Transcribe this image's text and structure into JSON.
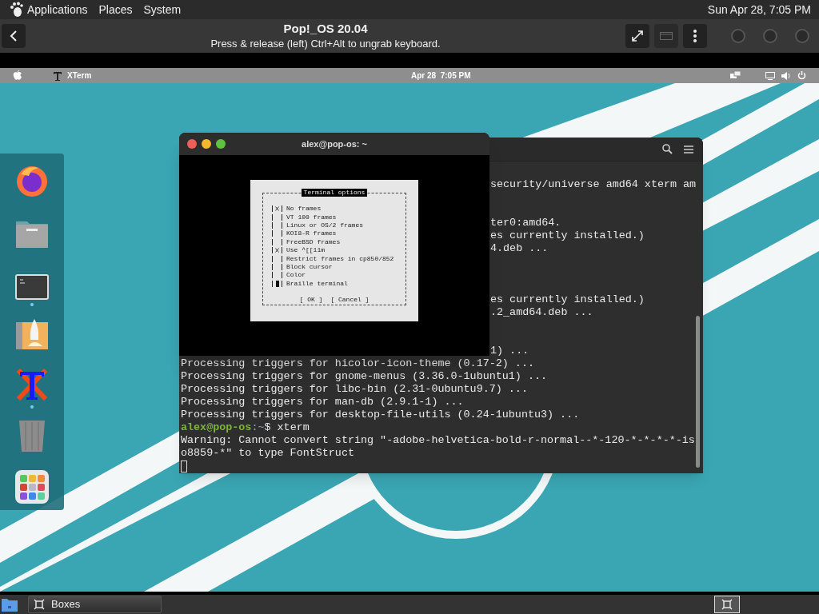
{
  "host_top_bar": {
    "menus": [
      "Applications",
      "Places",
      "System"
    ],
    "clock": "Sun Apr 28, 7:05 PM"
  },
  "boxes_header": {
    "title": "Pop!_OS 20.04",
    "subtitle": "Press & release (left) Ctrl+Alt to ungrab keyboard."
  },
  "guest_top_bar": {
    "app_name": "XTerm",
    "clock": "Apr 28  7:05 PM"
  },
  "dock": {
    "items": [
      {
        "kind": "firefox",
        "running": false
      },
      {
        "kind": "files",
        "running": false
      },
      {
        "kind": "terminal",
        "running": true
      },
      {
        "kind": "installer",
        "running": false
      },
      {
        "kind": "xterm",
        "running": true
      },
      {
        "kind": "trash",
        "running": false
      },
      {
        "kind": "apps",
        "running": false
      }
    ]
  },
  "back_terminal": {
    "lines": [
      {
        "kind": "clipped",
        "text": "security/universe amd64 xterm am"
      },
      {
        "kind": "hidden"
      },
      {
        "kind": "hidden"
      },
      {
        "kind": "clipped",
        "text": "ter0:amd64."
      },
      {
        "kind": "clipped",
        "text": "es currently installed.)"
      },
      {
        "kind": "clipped",
        "text": "4.deb ..."
      },
      {
        "kind": "hidden"
      },
      {
        "kind": "hidden"
      },
      {
        "kind": "hidden"
      },
      {
        "kind": "clipped",
        "text": "es currently installed.)"
      },
      {
        "kind": "clipped",
        "text": ".2_amd64.deb ..."
      },
      {
        "kind": "hidden"
      },
      {
        "kind": "hidden"
      },
      {
        "kind": "clipped",
        "text": "1) ..."
      },
      {
        "kind": "full",
        "text": "Processing triggers for hicolor-icon-theme (0.17-2) ..."
      },
      {
        "kind": "full",
        "text": "Processing triggers for gnome-menus (3.36.0-1ubuntu1) ..."
      },
      {
        "kind": "full",
        "text": "Processing triggers for libc-bin (2.31-0ubuntu9.7) ..."
      },
      {
        "kind": "full",
        "text": "Processing triggers for man-db (2.9.1-1) ..."
      },
      {
        "kind": "full",
        "text": "Processing triggers for desktop-file-utils (0.24-1ubuntu3) ..."
      },
      {
        "kind": "prompt",
        "user_host": "alex@pop-os",
        "path": ":~",
        "command": "$ xterm"
      },
      {
        "kind": "full",
        "text": "Warning: Cannot convert string \"-adobe-helvetica-bold-r-normal--*-120-*-*-*-*-is"
      },
      {
        "kind": "full",
        "text": "o8859-*\" to type FontStruct"
      },
      {
        "kind": "cursor"
      }
    ]
  },
  "xterm_window": {
    "title": "alex@pop-os: ~",
    "dialog": {
      "title": "Terminal options",
      "options": [
        {
          "label": "No frames",
          "checked": true,
          "focused": false
        },
        {
          "label": "VT 100 frames",
          "checked": false,
          "focused": false
        },
        {
          "label": "Linux or OS/2 frames",
          "checked": false,
          "focused": false
        },
        {
          "label": "KOI8-R frames",
          "checked": false,
          "focused": false
        },
        {
          "label": "FreeBSD frames",
          "checked": false,
          "focused": false
        },
        {
          "label": "Use ^[[11m",
          "checked": true,
          "focused": false
        },
        {
          "label": "Restrict frames in cp850/852",
          "checked": false,
          "focused": false
        },
        {
          "label": "Block cursor",
          "checked": false,
          "focused": false
        },
        {
          "label": "Color",
          "checked": false,
          "focused": false
        },
        {
          "label": "Braille terminal",
          "checked": false,
          "focused": true
        }
      ],
      "buttons": [
        "[ OK ]",
        "[ Cancel ]"
      ]
    }
  },
  "taskbar": {
    "tasks": [
      {
        "label": "Boxes",
        "selected": false
      }
    ]
  }
}
